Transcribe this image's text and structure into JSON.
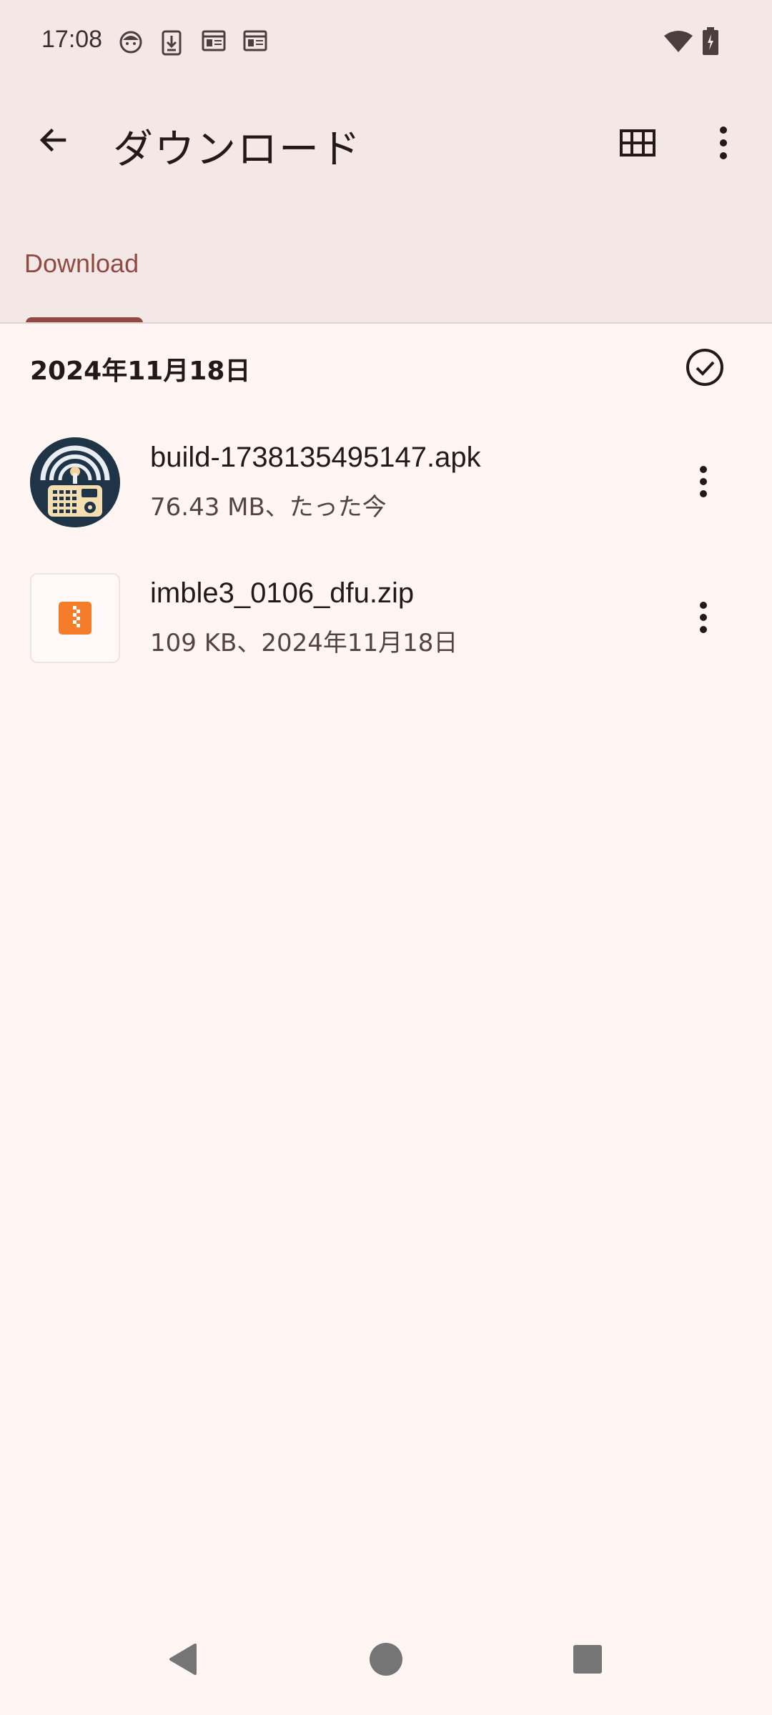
{
  "status_bar": {
    "time": "17:08",
    "left_icons": [
      "face-icon",
      "download-icon",
      "calendar-icon",
      "calendar-icon"
    ],
    "right_icons": [
      "wifi-icon",
      "battery-charging-icon"
    ]
  },
  "app_bar": {
    "back_icon": "arrow-back-icon",
    "title": "ダウンロード",
    "grid_icon": "grid-view-icon",
    "more_icon": "more-vert-icon"
  },
  "tabs": [
    {
      "label": "Download",
      "selected": true
    }
  ],
  "section": {
    "date_header": "2024年11月18日",
    "select_all_icon": "check-circle-icon"
  },
  "files": [
    {
      "name": "build-1738135495147.apk",
      "meta": "76.43 MB、たった今",
      "thumbnail": "apk-app-icon"
    },
    {
      "name": "imble3_0106_dfu.zip",
      "meta": "109 KB、2024年11月18日",
      "thumbnail": "zip-file-icon"
    }
  ],
  "nav_bar": {
    "back": "nav-back-icon",
    "home": "nav-home-icon",
    "recents": "nav-recents-icon"
  },
  "colors": {
    "accent": "#904a43",
    "top_background": "#f3e8e6",
    "page_background": "#fff6f4",
    "zip_orange": "#f57c29"
  }
}
